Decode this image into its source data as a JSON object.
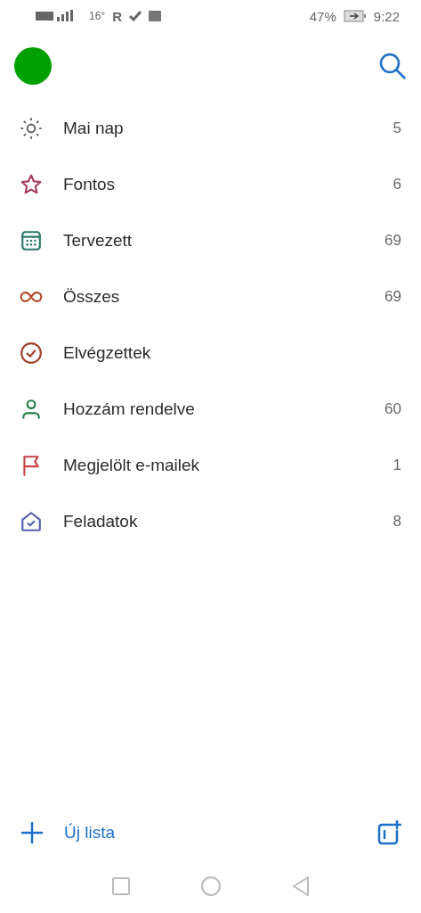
{
  "status_bar": {
    "temperature": "16°",
    "carrier": "R",
    "battery": "47%",
    "time": "9:22"
  },
  "avatar": {
    "color": "#00a000"
  },
  "lists": [
    {
      "kind": "sun",
      "label": "Mai nap",
      "count": "5",
      "color": "#6b6b6b"
    },
    {
      "kind": "star",
      "label": "Fontos",
      "count": "6",
      "color": "#a63d62"
    },
    {
      "kind": "calendar",
      "label": "Tervezett",
      "count": "69",
      "color": "#2a7a6a"
    },
    {
      "kind": "infinity",
      "label": "Összes",
      "count": "69",
      "color": "#b04a2a"
    },
    {
      "kind": "check",
      "label": "Elvégzettek",
      "color": "#a0462e"
    },
    {
      "kind": "person",
      "label": "Hozzám rendelve",
      "count": "60",
      "color": "#247a4a"
    },
    {
      "kind": "flag",
      "label": "Megjelölt e-mailek",
      "count": "1",
      "color": "#c8464a"
    },
    {
      "kind": "house",
      "label": "Feladatok",
      "count": "8",
      "color": "#5560b0"
    }
  ],
  "footer": {
    "new_list": "Új lista"
  }
}
